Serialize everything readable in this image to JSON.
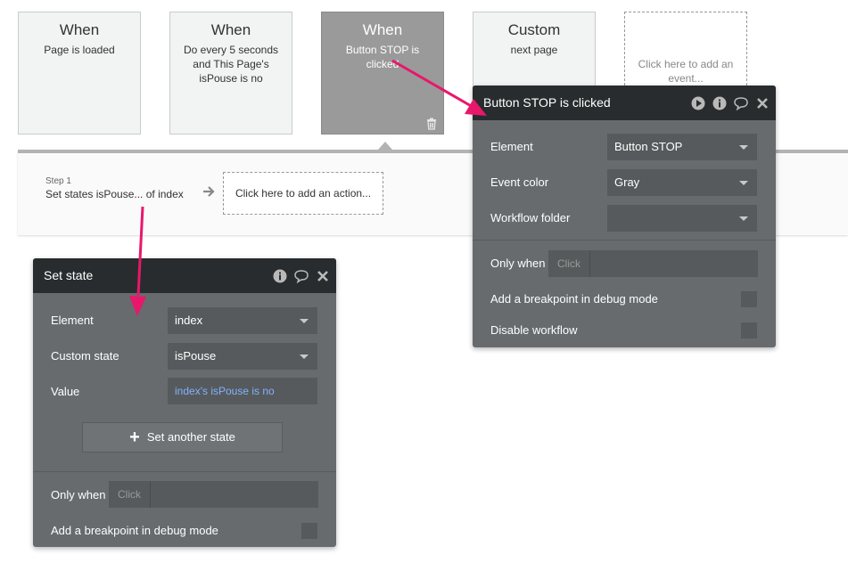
{
  "events": [
    {
      "title": "When",
      "subtitle": "Page is loaded"
    },
    {
      "title": "When",
      "subtitle": "Do every 5 seconds and This Page's isPouse is no"
    },
    {
      "title": "When",
      "subtitle": "Button STOP is clicked"
    },
    {
      "title": "Custom",
      "subtitle": "next page"
    }
  ],
  "add_event_label": "Click here to add an event...",
  "step": {
    "label": "Step 1",
    "title": "Set states isPouse... of index"
  },
  "add_action_label": "Click here to add an action...",
  "event_panel": {
    "title": "Button STOP is clicked",
    "element_label": "Element",
    "element_value": "Button STOP",
    "color_label": "Event color",
    "color_value": "Gray",
    "folder_label": "Workflow folder",
    "folder_value": "",
    "only_when_label": "Only when",
    "only_when_placeholder": "Click",
    "breakpoint_label": "Add a breakpoint in debug mode",
    "disable_label": "Disable workflow"
  },
  "state_panel": {
    "title": "Set state",
    "element_label": "Element",
    "element_value": "index",
    "state_label": "Custom state",
    "state_value": "isPouse",
    "value_label": "Value",
    "value_value": "index's isPouse is no",
    "set_another_label": "Set another state",
    "only_when_label": "Only when",
    "only_when_placeholder": "Click",
    "breakpoint_label": "Add a breakpoint in debug mode"
  },
  "colors": {
    "accent": "#e8176b",
    "panel": "#676b6e",
    "panel_head": "#292c2e",
    "link": "#7fb3ff"
  }
}
